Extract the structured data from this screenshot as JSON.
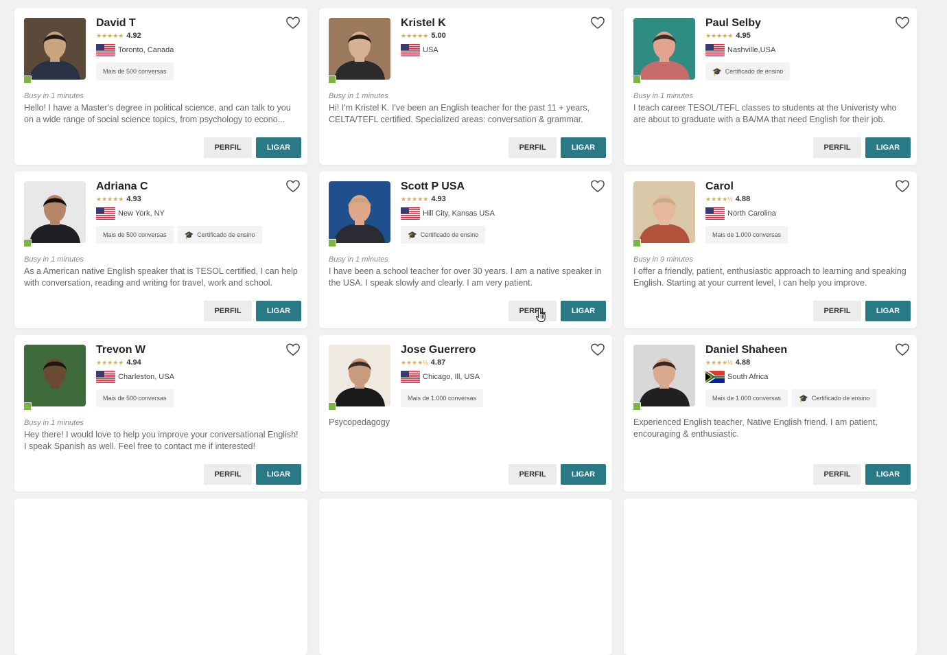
{
  "colors": {
    "accent": "#297a86",
    "star": "#f0a830",
    "online": "#7cb342"
  },
  "buttons": {
    "profile": "PERFIL",
    "call": "LIGAR"
  },
  "tutors": [
    {
      "name": "David T",
      "rating": "4.92",
      "stars": "★★★★★",
      "location": "Toronto, Canada",
      "flag": "us",
      "status": "Busy in 1 minutes",
      "badges": [
        {
          "label": "Mais de 500 conversas",
          "icon": ""
        }
      ],
      "description": "Hello! I have a Master's degree in political science, and can talk to you on a wide range of social science topics, from psychology to econo...",
      "photo_bg": "#5b4a3a",
      "skin": "#c9a27e",
      "hair": "#1d1a18",
      "shirt": "#2a3145"
    },
    {
      "name": "Kristel K",
      "rating": "5.00",
      "stars": "★★★★★",
      "location": "USA",
      "flag": "us",
      "status": "Busy in 1 minutes",
      "badges": [],
      "description": "Hi! I'm Kristel K. I've been an English teacher for the past 11 + years, CELTA/TEFL certified. Specialized areas: conversation & grammar.",
      "photo_bg": "#9c7a5e",
      "skin": "#d8b193",
      "hair": "#2a1d16",
      "shirt": "#2b2b2b"
    },
    {
      "name": "Paul Selby",
      "rating": "4.95",
      "stars": "★★★★★",
      "location": "Nashville,USA",
      "flag": "us",
      "status": "Busy in 1 minutes",
      "badges": [
        {
          "label": "Certificado de ensino",
          "icon": "graduation-cap-icon"
        }
      ],
      "description": "I teach career TESOL/TEFL classes to students at the Univeristy who are about to graduate with a BA/MA that need English for their job.",
      "photo_bg": "#2e8c80",
      "skin": "#e2a48e",
      "hair": "#3a2f2a",
      "shirt": "#c86b6b"
    },
    {
      "name": "Adriana C",
      "rating": "4.93",
      "stars": "★★★★★",
      "location": "New York, NY",
      "flag": "us",
      "status": "Busy in 1 minutes",
      "badges": [
        {
          "label": "Mais de 500 conversas",
          "icon": ""
        },
        {
          "label": "Certificado de ensino",
          "icon": "graduation-cap-icon"
        }
      ],
      "description": "As a American native English speaker that is TESOL certified, I can help with conversation, reading and writing for travel, work and school.",
      "photo_bg": "#e8e8e8",
      "skin": "#b68466",
      "hair": "#151210",
      "shirt": "#1e1e24"
    },
    {
      "name": "Scott P USA",
      "rating": "4.93",
      "stars": "★★★★★",
      "location": "Hill City, Kansas USA",
      "flag": "us",
      "status": "Busy in 1 minutes",
      "badges": [
        {
          "label": "Certificado de ensino",
          "icon": "graduation-cap-icon"
        }
      ],
      "description": "I have been a school teacher for over 30 years. I am a native speaker in the USA. I speak slowly and clearly. I am very patient.",
      "photo_bg": "#1f4f8c",
      "skin": "#e0a88a",
      "hair": "#c8a57a",
      "shirt": "#2b2b33"
    },
    {
      "name": "Carol",
      "rating": "4.88",
      "stars": "★★★★½",
      "location": "North Carolina",
      "flag": "us",
      "status": "Busy in 9 minutes",
      "badges": [
        {
          "label": "Mais de 1.000 conversas",
          "icon": ""
        }
      ],
      "description": "I offer a friendly, patient, enthusiastic approach to learning and speaking English. Starting at your current level, I can help you improve.",
      "photo_bg": "#d9c9a8",
      "skin": "#e6b89c",
      "hair": "#c7ab86",
      "shirt": "#b3513b"
    },
    {
      "name": "Trevon W",
      "rating": "4.94",
      "stars": "★★★★★",
      "location": "Charleston, USA",
      "flag": "us",
      "status": "Busy in 1 minutes",
      "badges": [
        {
          "label": "Mais de 500 conversas",
          "icon": ""
        }
      ],
      "description": "Hey there! I would love to help you improve your conversational English! I speak Spanish as well. Feel free to contact me if interested!",
      "photo_bg": "#3f6b3a",
      "skin": "#6b4a34",
      "hair": "#1d1612",
      "shirt": "#3f6b3a"
    },
    {
      "name": "Jose Guerrero",
      "rating": "4.87",
      "stars": "★★★★½",
      "location": "Chicago, Ill, USA",
      "flag": "us",
      "status": "",
      "badges": [
        {
          "label": "Mais de 1.000 conversas",
          "icon": ""
        }
      ],
      "description": "Psycopedagogy",
      "photo_bg": "#efe9df",
      "skin": "#c99a7b",
      "hair": "#3b2f28",
      "shirt": "#1a1a1a"
    },
    {
      "name": "Daniel Shaheen",
      "rating": "4.88",
      "stars": "★★★★½",
      "location": "South Africa",
      "flag": "za",
      "status": "",
      "badges": [
        {
          "label": "Mais de 1.000 conversas",
          "icon": ""
        },
        {
          "label": "Certificado de ensino",
          "icon": "graduation-cap-icon"
        }
      ],
      "description": "Experienced English teacher, Native English friend. I am patient, encouraging & enthusiastic.",
      "photo_bg": "#d8d8d8",
      "skin": "#d9a98d",
      "hair": "#3a2a20",
      "shirt": "#202020"
    }
  ]
}
